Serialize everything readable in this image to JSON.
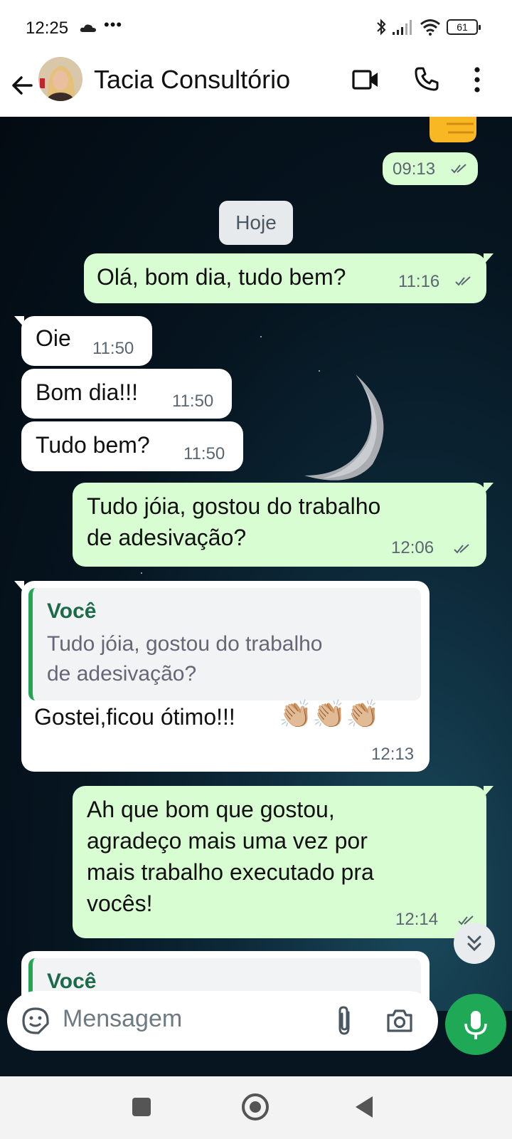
{
  "status_bar": {
    "time": "12:25",
    "dots": "•••",
    "battery": "61"
  },
  "header": {
    "contact_name": "Tacia Consultório"
  },
  "chat": {
    "partial_top_time": "09:13",
    "date_chip": "Hoje",
    "messages": [
      {
        "dir": "out",
        "text": "Olá, bom dia, tudo bem?",
        "time": "11:16"
      },
      {
        "dir": "in",
        "text": "Oie",
        "time": "11:50"
      },
      {
        "dir": "in",
        "text": "Bom dia!!!",
        "time": "11:50"
      },
      {
        "dir": "in",
        "text": "Tudo bem?",
        "time": "11:50"
      },
      {
        "dir": "out",
        "line1": "Tudo jóia, gostou do trabalho",
        "line2": "de adesivação?",
        "time": "12:06"
      },
      {
        "dir": "in",
        "reply_author": "Você",
        "reply_line1": "Tudo jóia, gostou do trabalho",
        "reply_line2": "de adesivação?",
        "text": "Gostei,ficou ótimo!!!",
        "emoji": "👏🏼👏🏼👏🏼",
        "time": "12:13"
      },
      {
        "dir": "out",
        "line1": "Ah que bom que gostou,",
        "line2": "agradeço mais uma vez por",
        "line3": "mais trabalho executado pra",
        "line4": "vocês!",
        "time": "12:14"
      },
      {
        "dir": "in",
        "reply_author": "Você"
      }
    ]
  },
  "input": {
    "placeholder": "Mensagem"
  },
  "colors": {
    "outgoing": "#d9fdd3",
    "incoming": "#ffffff",
    "accent": "#1fa956",
    "quote_bar": "#25a456"
  },
  "icons": [
    "back-arrow-icon",
    "video-call-icon",
    "phone-icon",
    "more-vert-icon",
    "sticker-icon",
    "attach-icon",
    "camera-icon",
    "mic-icon",
    "double-chevron-down-icon"
  ]
}
